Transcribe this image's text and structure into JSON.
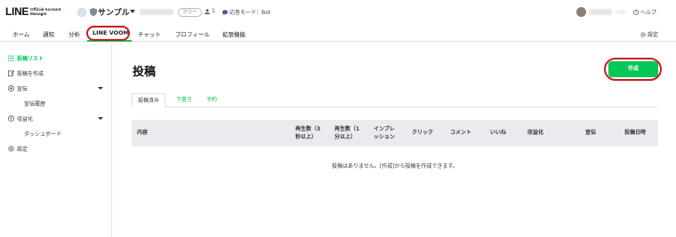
{
  "header": {
    "logo": "LINE",
    "logo_sub_1": "Official Account",
    "logo_sub_2": "Manager",
    "account_name": "サンプル",
    "plan_badge": "フリー",
    "friends_count": "1",
    "response_mode": "応答モード：Bot",
    "help": "ヘルプ"
  },
  "nav": {
    "items": [
      "ホーム",
      "通知",
      "分析",
      "LINE VOOM",
      "チャット",
      "プロフィール",
      "拡張機能"
    ],
    "active_index": 3,
    "settings": "設定"
  },
  "sidebar": {
    "post_list": "投稿リスト",
    "create_post": "投稿を作成",
    "promotion": "宣伝",
    "promotion_history": "宣伝履歴",
    "monetization": "収益化",
    "dashboard": "ダッシュボード",
    "settings": "設定"
  },
  "main": {
    "title": "投稿",
    "create_button": "作成",
    "tabs": [
      "投稿済み",
      "下書き",
      "予約"
    ],
    "columns": {
      "content": "内容",
      "plays3_l1": "再生数（3",
      "plays3_l2": "秒以上）",
      "plays1_l1": "再生数（1",
      "plays1_l2": "分以上）",
      "imp_l1": "インプレ",
      "imp_l2": "ッション",
      "click": "クリック",
      "comment": "コメント",
      "like": "いいね",
      "monetize": "収益化",
      "promo": "宣伝",
      "date": "投稿日時"
    },
    "empty_message": "投稿はありません。[作成]から投稿を作成できます。"
  },
  "colors": {
    "accent": "#06c755",
    "highlight_ring": "#c41e1e"
  }
}
